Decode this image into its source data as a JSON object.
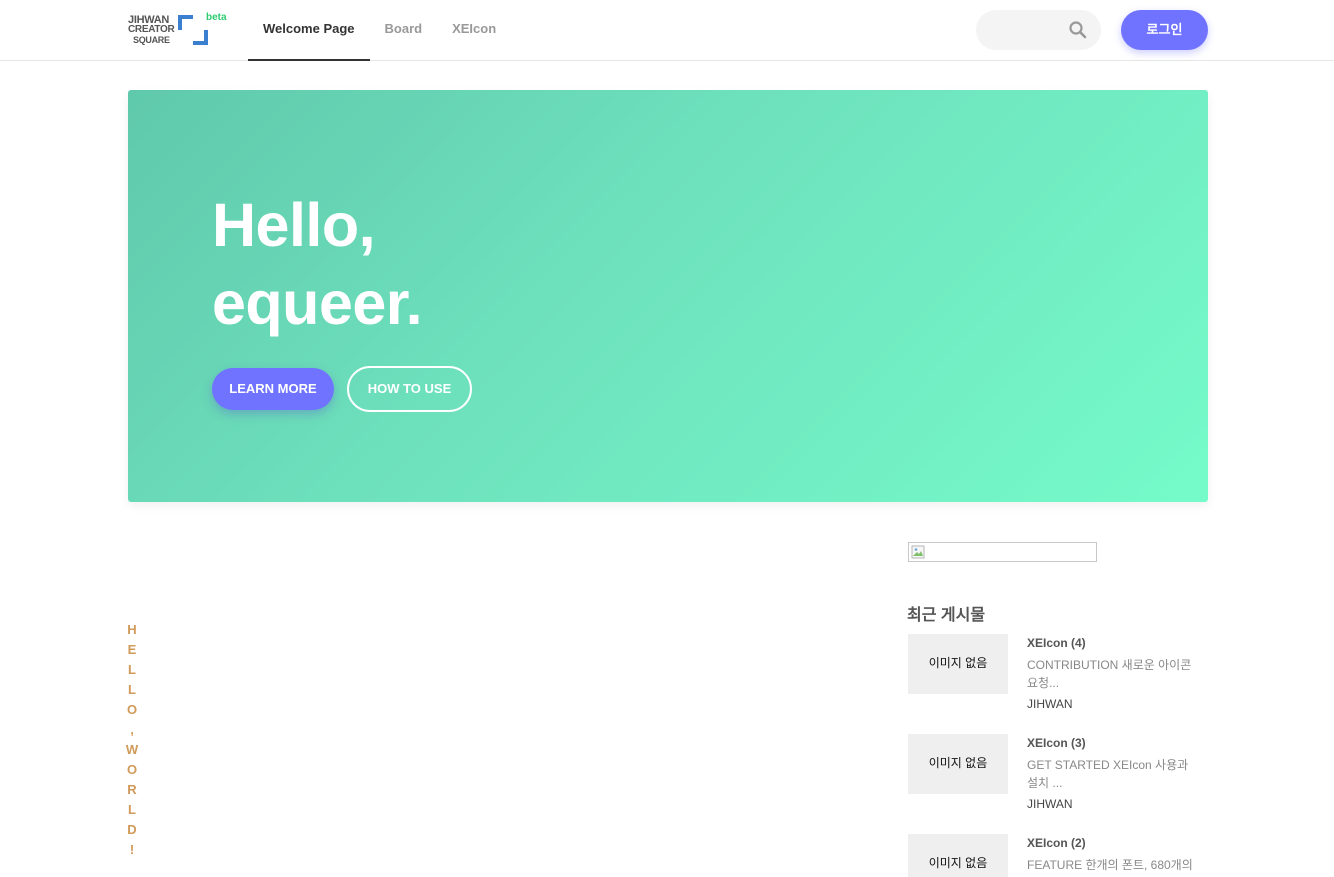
{
  "header": {
    "logo": {
      "line1": "JIHWAN",
      "line2": "CREATOR",
      "line3": "SQUARE",
      "badge": "beta"
    },
    "nav": [
      {
        "label": "Welcome Page",
        "active": true
      },
      {
        "label": "Board",
        "active": false
      },
      {
        "label": "XEIcon",
        "active": false
      }
    ],
    "search": {
      "value": "",
      "placeholder": ""
    },
    "login_label": "로그인"
  },
  "hero": {
    "title_line1": "Hello,",
    "title_line2": "equeer.",
    "learn_more_label": "LEARN MORE",
    "how_to_use_label": "HOW TO USE"
  },
  "vertical_text": [
    "H",
    "E",
    "L",
    "L",
    "O",
    ",",
    "W",
    "O",
    "R",
    "L",
    "D",
    "!"
  ],
  "sidebar": {
    "recent_title": "최근 게시물",
    "posts": [
      {
        "thumb": "이미지 없음",
        "title": "XEIcon (4)",
        "desc": "CONTRIBUTION 새로운 아이콘 요청...",
        "author": "JIHWAN"
      },
      {
        "thumb": "이미지 없음",
        "title": "XEIcon (3)",
        "desc": "GET STARTED XEIcon 사용과 설치 ...",
        "author": "JIHWAN"
      },
      {
        "thumb": "이미지 없음",
        "title": "XEIcon (2)",
        "desc": "FEATURE 한개의 폰트, 680개의",
        "author": ""
      }
    ]
  },
  "colors": {
    "accent": "#6f73ff",
    "hero_start": "#60c9ac",
    "hero_end": "#75fbca",
    "vertical_text": "#d19a59",
    "logo_beta": "#2ecc71",
    "logo_bracket": "#3b7fd1"
  },
  "icons": {
    "search": "search-icon",
    "broken_image": "broken-image-icon"
  }
}
